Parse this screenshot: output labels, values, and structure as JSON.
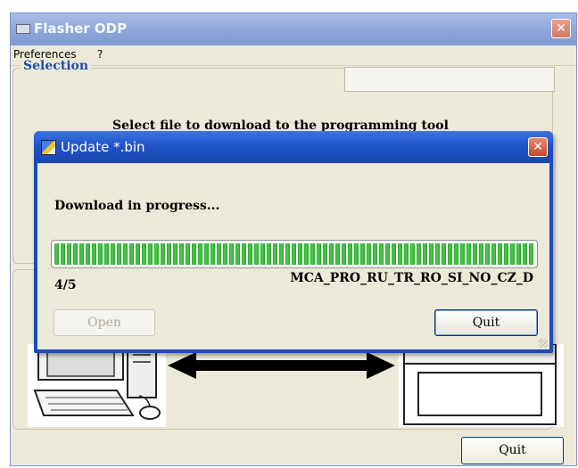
{
  "main_window": {
    "title": "Flasher ODP",
    "close_glyph": "✕",
    "menu": [
      "Preferences",
      "?"
    ],
    "selection_legend": "Selection",
    "selection_prompt": "Select file to download to the programming tool",
    "quit_label": "Quit"
  },
  "dialog": {
    "title": "Update *.bin",
    "close_glyph": "✕",
    "status": "Download in progress...",
    "progress_fraction": 1.0,
    "count": "4/5",
    "file_name": "MCA_PRO_RU_TR_RO_SI_NO_CZ_D",
    "open_label": "Open",
    "quit_label": "Quit"
  },
  "icons": {
    "app": "window-icon",
    "dialog": "update-icon",
    "illustration": [
      "computer-icon",
      "double-arrow-icon",
      "programming-tool-icon"
    ]
  },
  "colors": {
    "titlebar_active": "#2154c8",
    "titlebar_inactive": "#8fa8da",
    "progress": "#2ba52b",
    "legend": "#1b4fa8",
    "close": "#c9472a"
  }
}
